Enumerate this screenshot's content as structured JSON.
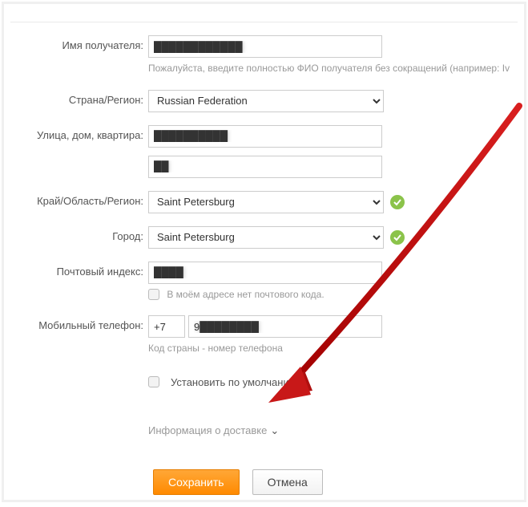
{
  "labels": {
    "name": "Имя получателя:",
    "country": "Страна/Регион:",
    "street": "Улица, дом, квартира:",
    "region": "Край/Область/Регион:",
    "city": "Город:",
    "zip": "Почтовый индекс:",
    "phone": "Мобильный телефон:"
  },
  "values": {
    "name": "████████████",
    "country": "Russian Federation",
    "street1": "██████████",
    "street2": "██",
    "region": "Saint Petersburg",
    "city": "Saint Petersburg",
    "zip": "████",
    "phone_code": "+7",
    "phone_num": "9████████"
  },
  "help": {
    "name": "Пожалуйста, введите полностью ФИО получателя без сокращений (например: Iv",
    "noZip": "В моём адресе нет почтового кода.",
    "phone": "Код страны - номер телефона"
  },
  "checkbox": {
    "default": "Установить по умолчанию"
  },
  "links": {
    "shippingInfo": "Информация о доставке"
  },
  "buttons": {
    "save": "Сохранить",
    "cancel": "Отмена"
  }
}
